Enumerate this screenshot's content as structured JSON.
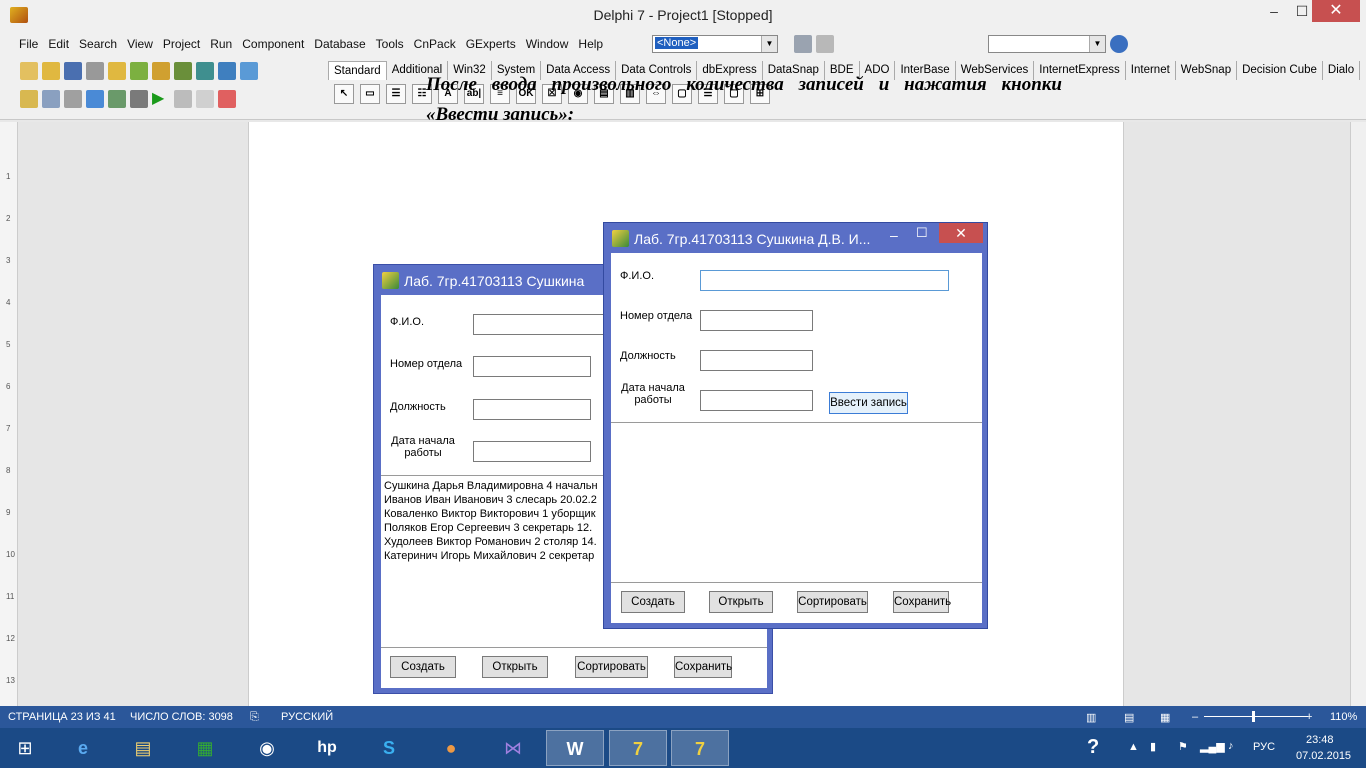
{
  "ide": {
    "title": "Delphi 7 - Project1 [Stopped]",
    "menu": [
      "File",
      "Edit",
      "Search",
      "View",
      "Project",
      "Run",
      "Component",
      "Database",
      "Tools",
      "CnPack",
      "GExperts",
      "Window",
      "Help"
    ],
    "target_combo": "<None>",
    "palette_tabs": [
      "Standard",
      "Additional",
      "Win32",
      "System",
      "Data Access",
      "Data Controls",
      "dbExpress",
      "DataSnap",
      "BDE",
      "ADO",
      "InterBase",
      "WebServices",
      "InternetExpress",
      "Internet",
      "WebSnap",
      "Decision Cube",
      "Dialo"
    ],
    "palette_icons": [
      "pointer-tool",
      "frames",
      "mainmenu",
      "popupmenu",
      "label",
      "edit",
      "memo",
      "button",
      "checkbox",
      "radiobutton",
      "listbox",
      "combobox",
      "scrollbar",
      "groupbox",
      "radiogroup",
      "panel",
      "actionlist"
    ],
    "palette_glyphs": [
      "↖",
      "▭",
      "☰",
      "☷",
      "A",
      "ab|",
      "≡",
      "OK",
      "☒",
      "◉",
      "▤",
      "▥",
      "⇔",
      "▢",
      "☰",
      "▢",
      "⊞"
    ]
  },
  "document": {
    "para_line1": "После ввода произвольного количества записей и нажатия кнопки",
    "para_line2": "«Ввести запись»:",
    "ruler_marks": [
      "1",
      "2",
      "3",
      "4",
      "5",
      "6",
      "7",
      "8",
      "9",
      "10",
      "11",
      "12",
      "13"
    ]
  },
  "form_back": {
    "title": "Лаб. 7гр.41703113 Сушкина",
    "labels": {
      "fio": "Ф.И.О.",
      "dept": "Номер отдела",
      "pos": "Должность",
      "date1": "Дата начала",
      "date2": "работы"
    },
    "memo": [
      "Сушкина Дарья Владимировна 4 начальн",
      "Иванов Иван Иванович 3 слесарь 20.02.2",
      "Коваленко Виктор Викторович 1 уборщик",
      "Поляков Егор Сергеевич 3 секретарь 12.",
      "Худолеев Виктор Романович 2 столяр 14.",
      "Катеринич Игорь Михайлович 2 секретар"
    ],
    "buttons": {
      "create": "Создать",
      "open": "Открыть",
      "sort": "Сортировать",
      "save": "Сохранить"
    }
  },
  "form_front": {
    "title": "Лаб. 7гр.41703113 Сушкина Д.В. И...",
    "labels": {
      "fio": "Ф.И.О.",
      "dept": "Номер отдела",
      "pos": "Должность",
      "date1": "Дата начала",
      "date2": "работы"
    },
    "enter_button": "Ввести запись",
    "buttons": {
      "create": "Создать",
      "open": "Открыть",
      "sort": "Сортировать",
      "save": "Сохранить"
    }
  },
  "statusbar": {
    "page": "СТРАНИЦА 23 ИЗ 41",
    "words": "ЧИСЛО СЛОВ: 3098",
    "lang": "РУССКИЙ",
    "zoom": "110%"
  },
  "taskbar": {
    "lang": "РУС",
    "time": "23:48",
    "date": "07.02.2015"
  },
  "colors": {
    "accent": "#2b579a",
    "form_frame": "#5a6fc6",
    "close": "#c75050"
  }
}
